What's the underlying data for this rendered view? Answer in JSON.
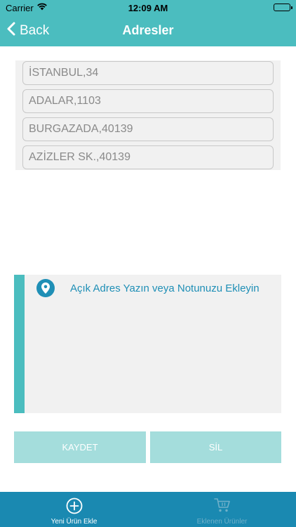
{
  "status_bar": {
    "carrier": "Carrier",
    "time": "12:09 AM"
  },
  "nav": {
    "back_label": "Back",
    "title": "Adresler"
  },
  "addresses": [
    "İSTANBUL,34",
    "ADALAR,1103",
    "BURGAZADA,40139",
    "AZİZLER SK.,40139"
  ],
  "note": {
    "placeholder": "Açık Adres Yazın veya Notunuzu Ekleyin"
  },
  "buttons": {
    "save_label": "KAYDET",
    "delete_label": "SİL"
  },
  "tabs": [
    {
      "label": "Yeni Ürün Ekle",
      "icon": "plus-circle-icon",
      "active": true
    },
    {
      "label": "Eklenen Ürünler",
      "icon": "cart-icon",
      "active": false
    }
  ],
  "colors": {
    "primary": "#4bbdbf",
    "tab_bar": "#1a89b1",
    "button": "#a4dddc",
    "note_text": "#1f8fb6"
  }
}
